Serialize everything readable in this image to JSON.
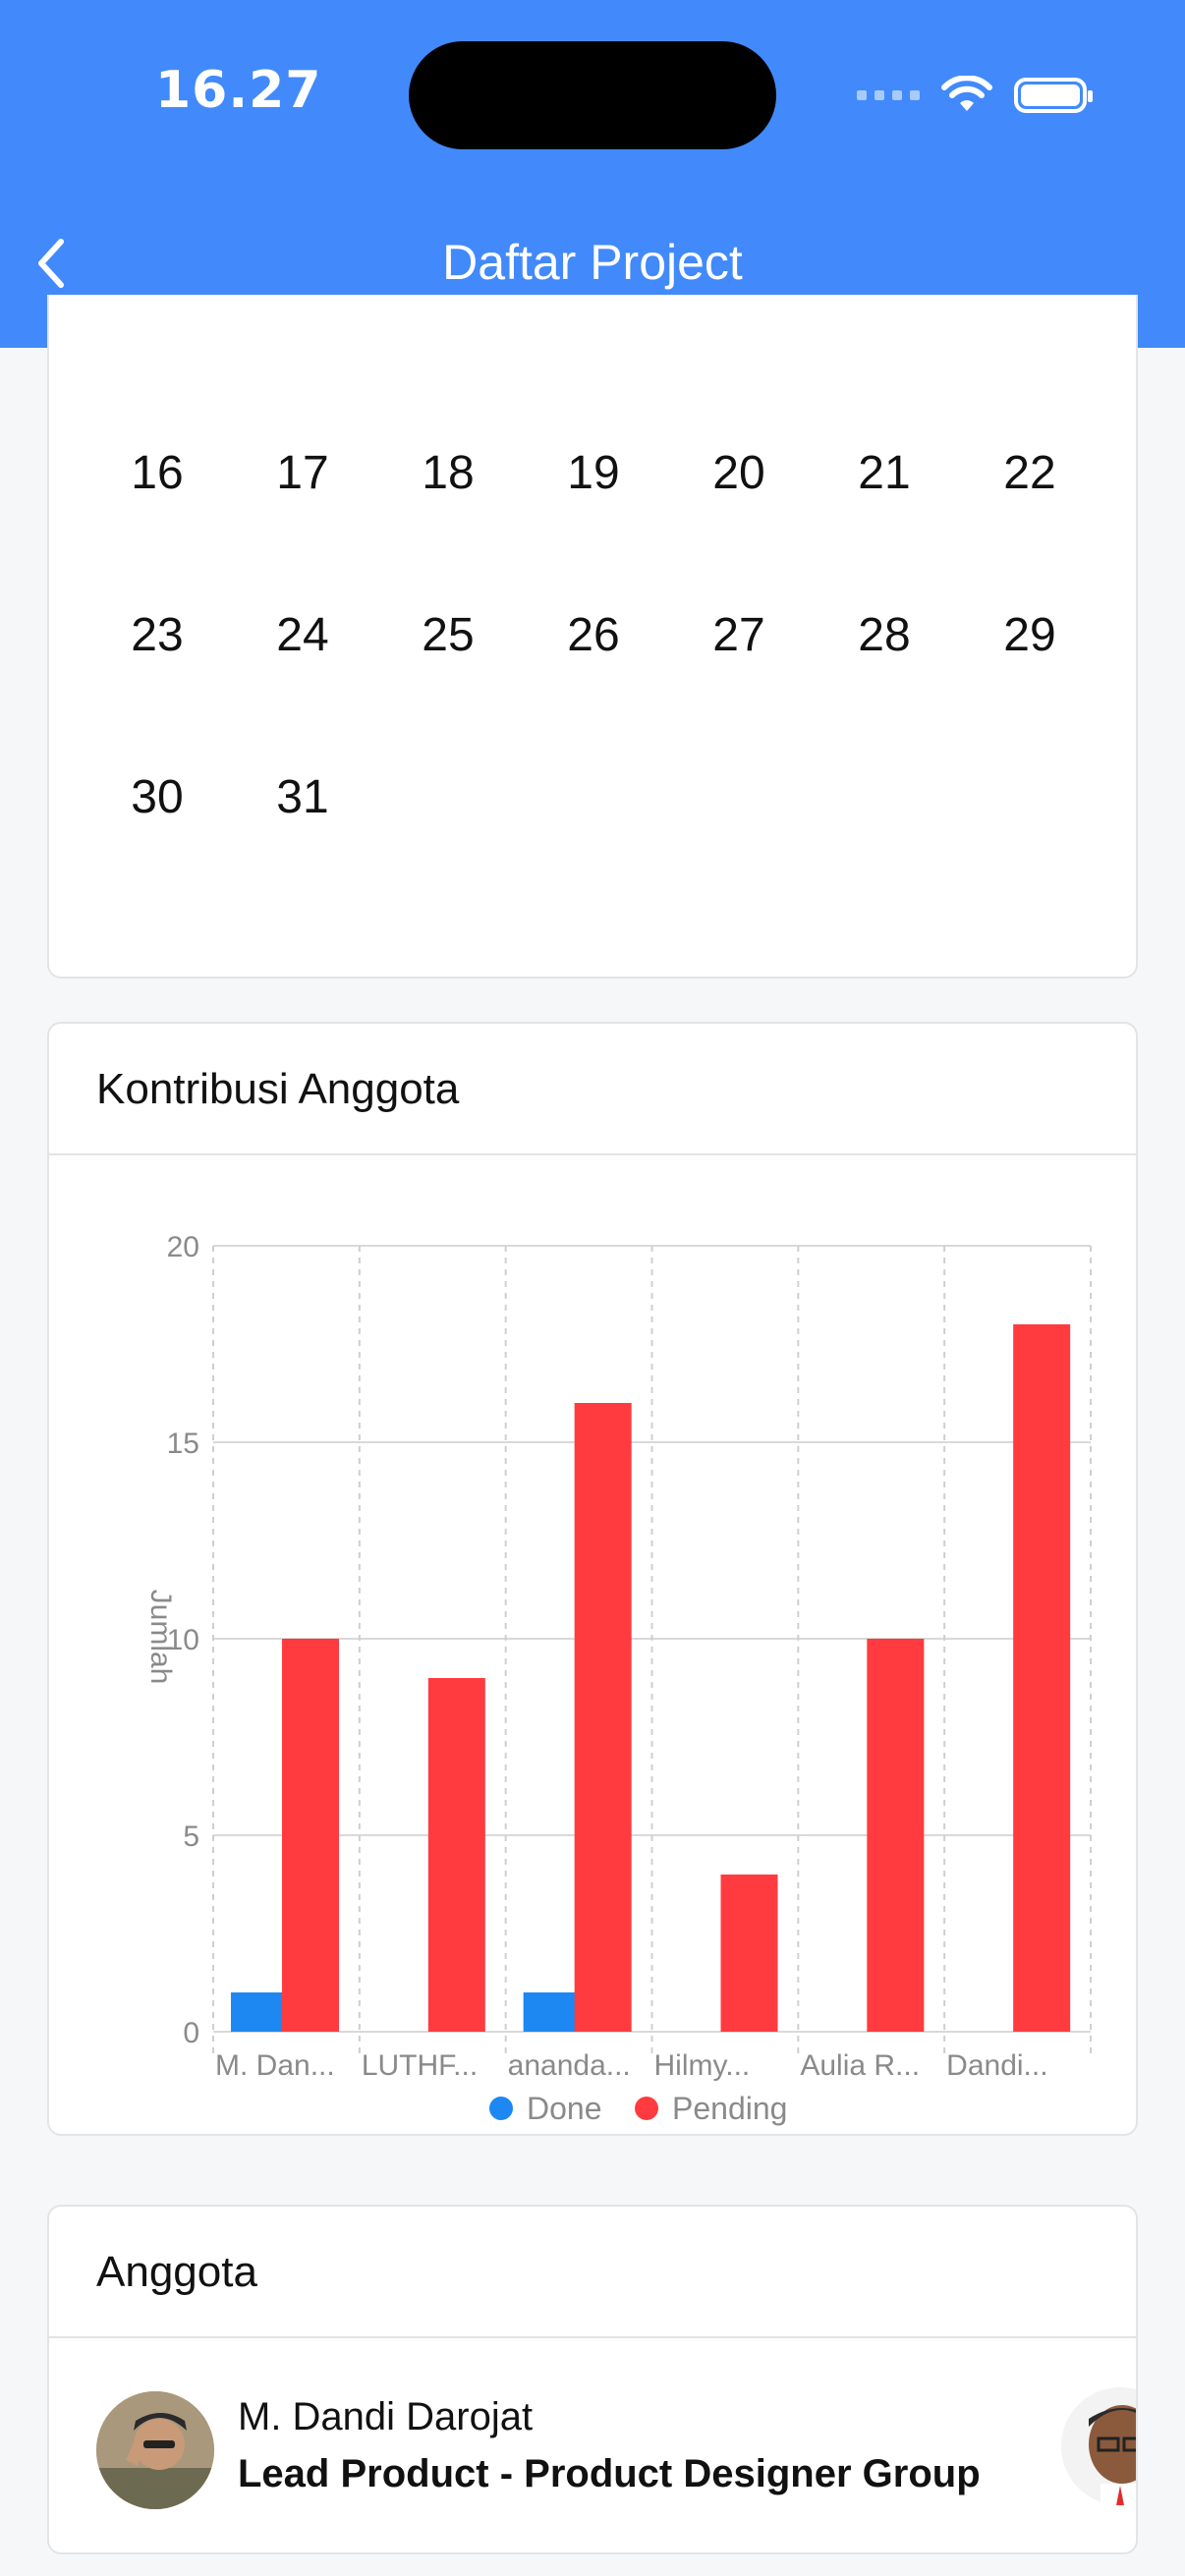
{
  "status_bar": {
    "time": "16.27"
  },
  "app_bar": {
    "title": "Daftar Project"
  },
  "calendar": {
    "days": [
      "16",
      "17",
      "18",
      "19",
      "20",
      "21",
      "22",
      "23",
      "24",
      "25",
      "26",
      "27",
      "28",
      "29",
      "30",
      "31"
    ]
  },
  "contribution": {
    "title": "Kontribusi Anggota"
  },
  "chart_data": {
    "type": "bar",
    "title": "Kontribusi Anggota",
    "ylabel": "Jumlah",
    "xlabel": "",
    "ylim": [
      0,
      20
    ],
    "yticks": [
      0,
      5,
      10,
      15,
      20
    ],
    "categories": [
      "M. Dan...",
      "LUTHF...",
      "ananda...",
      "Hilmy...",
      "Aulia R...",
      "Dandi..."
    ],
    "series": [
      {
        "name": "Done",
        "color": "#1e88f2",
        "values": [
          1,
          0,
          1,
          0,
          0,
          0
        ]
      },
      {
        "name": "Pending",
        "color": "#ff3b3f",
        "values": [
          10,
          9,
          16,
          4,
          10,
          18
        ]
      }
    ],
    "grid": true,
    "legend_position": "bottom"
  },
  "members": {
    "title": "Anggota",
    "items": [
      {
        "name": "M. Dandi Darojat",
        "role": "Lead Product - Product Designer Group"
      }
    ]
  },
  "icons": {
    "back": "back-chevron-icon",
    "wifi": "wifi-icon",
    "battery": "battery-icon"
  },
  "colors": {
    "primary": "#428afb",
    "done": "#1e88f2",
    "pending": "#ff3b3f"
  }
}
